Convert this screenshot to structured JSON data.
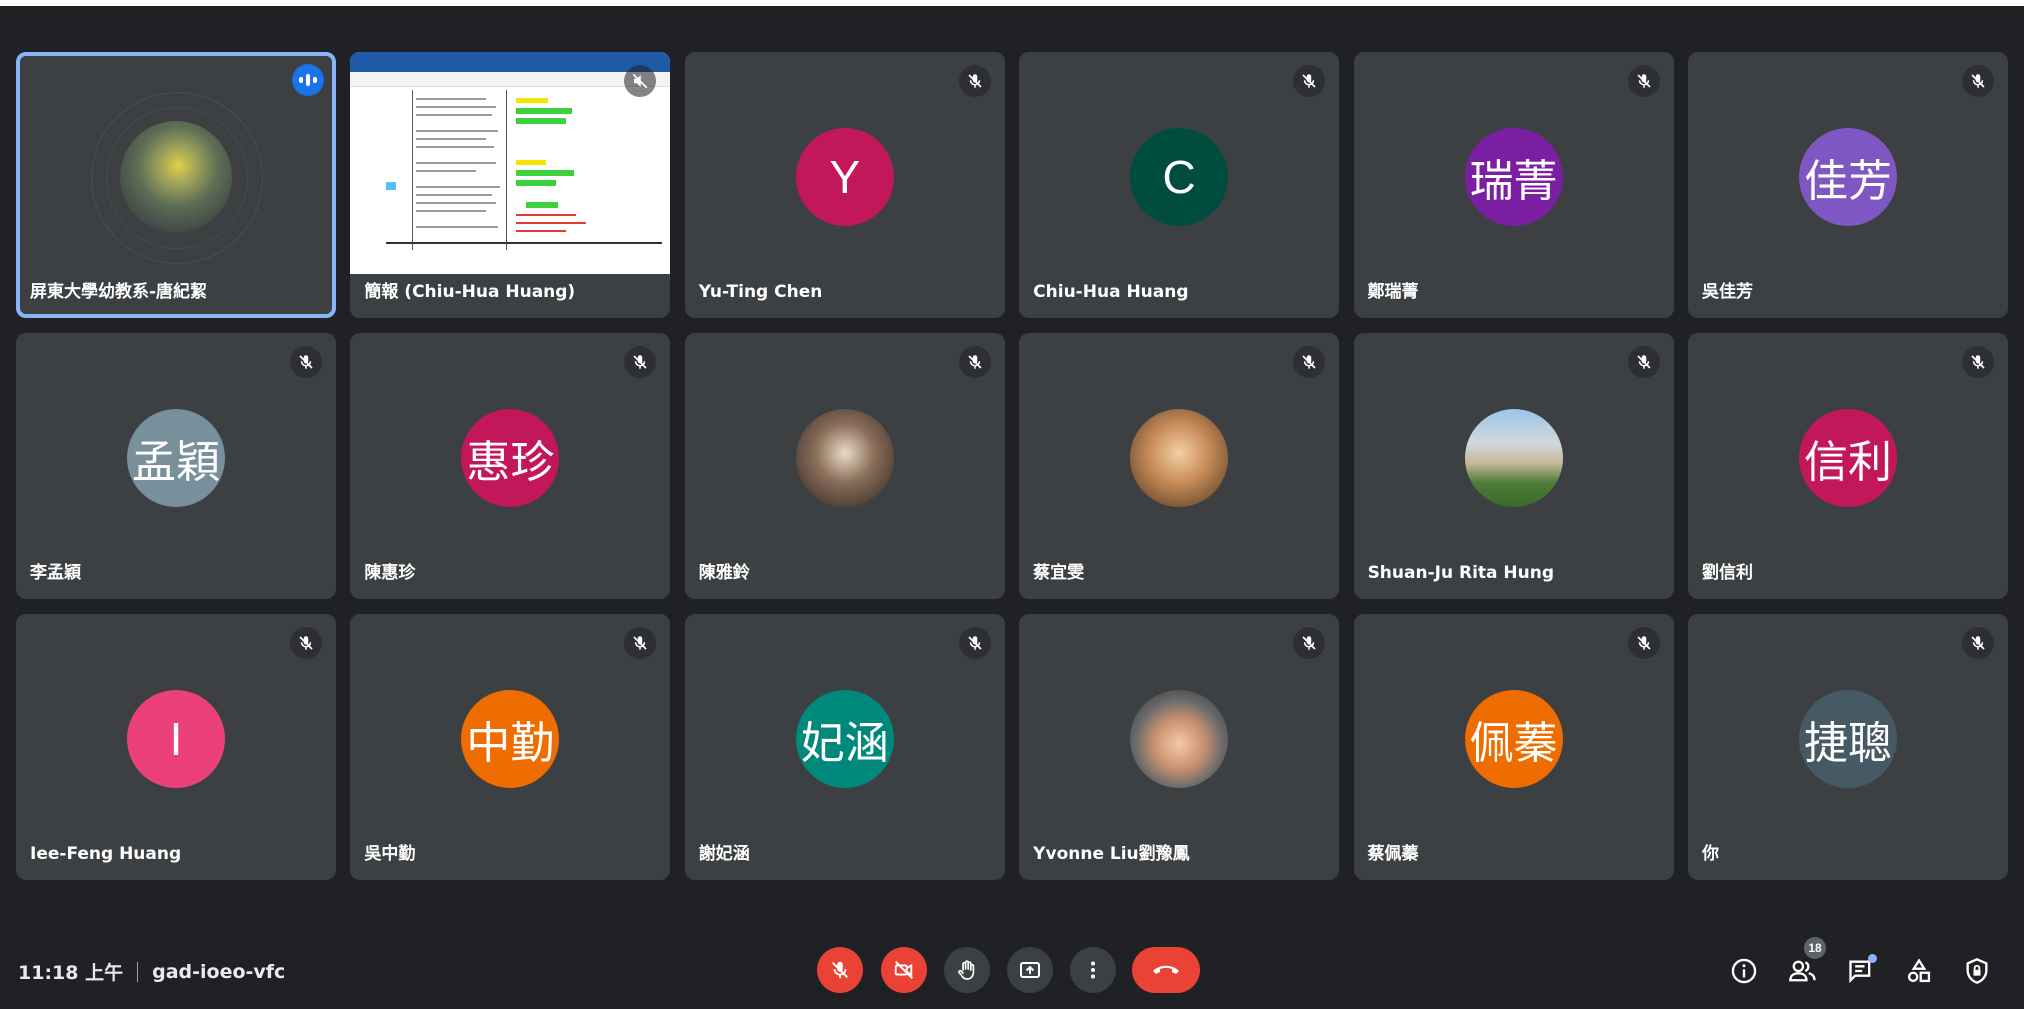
{
  "meeting": {
    "time": "11:18 上午",
    "code": "gad-ioeo-vfc",
    "participant_count": "18"
  },
  "tiles": [
    {
      "name": "屏東大學幼教系-唐紀絜",
      "type": "photo",
      "speaking": true
    },
    {
      "name": "簡報 (Chiu-Hua Huang)",
      "type": "screenshare",
      "muted_speaker": true
    },
    {
      "name": "Yu-Ting Chen",
      "initials": "Y",
      "color": "#c2185b"
    },
    {
      "name": "Chiu-Hua Huang",
      "initials": "C",
      "color": "#004d40"
    },
    {
      "name": "鄭瑞菁",
      "initials": "瑞菁",
      "color": "#7b1fa2"
    },
    {
      "name": "吳佳芳",
      "initials": "佳芳",
      "color": "#7e57c2"
    },
    {
      "name": "李孟穎",
      "initials": "孟穎",
      "color": "#78909c"
    },
    {
      "name": "陳惠珍",
      "initials": "惠珍",
      "color": "#c2185b"
    },
    {
      "name": "陳雅鈴",
      "type": "photo"
    },
    {
      "name": "蔡宜雯",
      "type": "photo"
    },
    {
      "name": "Shuan-Ju Rita Hung",
      "type": "photo"
    },
    {
      "name": "劉信利",
      "initials": "信利",
      "color": "#c2185b"
    },
    {
      "name": "Iee-Feng Huang",
      "initials": "I",
      "color": "#ec407a"
    },
    {
      "name": "吳中勤",
      "initials": "中勤",
      "color": "#ef6c00"
    },
    {
      "name": "謝妃涵",
      "initials": "妃涵",
      "color": "#00897b"
    },
    {
      "name": "Yvonne Liu劉豫鳳",
      "type": "photo"
    },
    {
      "name": "蔡佩蓁",
      "initials": "佩蓁",
      "color": "#ef6c00"
    },
    {
      "name": "你",
      "initials": "捷聰",
      "color": "#455a64"
    }
  ],
  "controls": {
    "mic": "mic-off-icon",
    "camera": "camera-off-icon",
    "raise_hand": "hand-icon",
    "present": "present-icon",
    "more": "more-vert-icon",
    "leave": "call-end-icon"
  },
  "colors": {
    "background": "#202124",
    "tile": "#3c4043",
    "accent": "#8ab4f8",
    "danger": "#ea4335"
  }
}
